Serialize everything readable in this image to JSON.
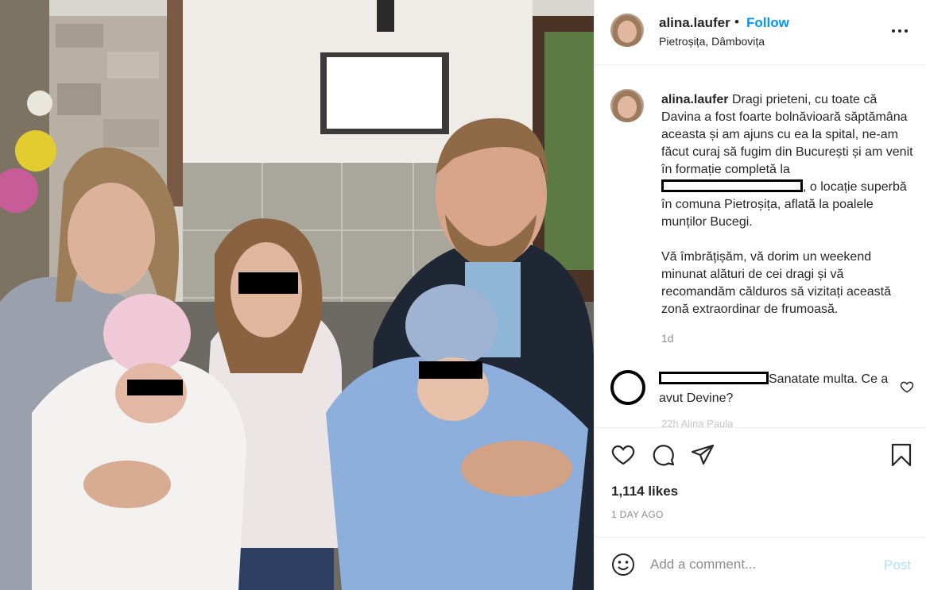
{
  "post": {
    "username": "alina.laufer",
    "dot": "•",
    "follow_label": "Follow",
    "location": "Pietroșița, Dâmbovița",
    "more_icon": "more-options-icon"
  },
  "caption": {
    "username": "alina.laufer",
    "text_before_redaction": "Dragi prieteni, cu toate că Davina a fost foarte bolnăvioară săptămâna aceasta și am ajuns cu ea la spital, ne-am făcut curaj să fugim din București și am venit în formație completă la",
    "text_after_redaction": ", o locație superbă în comuna Pietroșița, aflată la poalele munților Bucegi.",
    "paragraph_2": "Vă îmbrățișăm, vă dorim un weekend minunat alături de cei dragi și vă recomandăm călduros să vizitați această zonă extraordinar de frumoasă.",
    "time_ago": "1d"
  },
  "comment": {
    "text": "Sanatate multa. Ce a avut Devine?",
    "faded_preview": "22h  Alina Paula"
  },
  "actions": {
    "like_icon": "heart-icon",
    "comment_icon": "comment-bubble-icon",
    "share_icon": "paper-plane-icon",
    "save_icon": "bookmark-icon"
  },
  "likes": "1,114 likes",
  "date": "1 DAY AGO",
  "add_comment": {
    "placeholder": "Add a comment...",
    "post_label": "Post",
    "emoji_icon": "smiley-icon"
  },
  "colors": {
    "accent": "#0095f6",
    "post_disabled": "#b2dffc",
    "text": "#262626",
    "muted": "#8e8e8e",
    "divider": "#efefef"
  }
}
